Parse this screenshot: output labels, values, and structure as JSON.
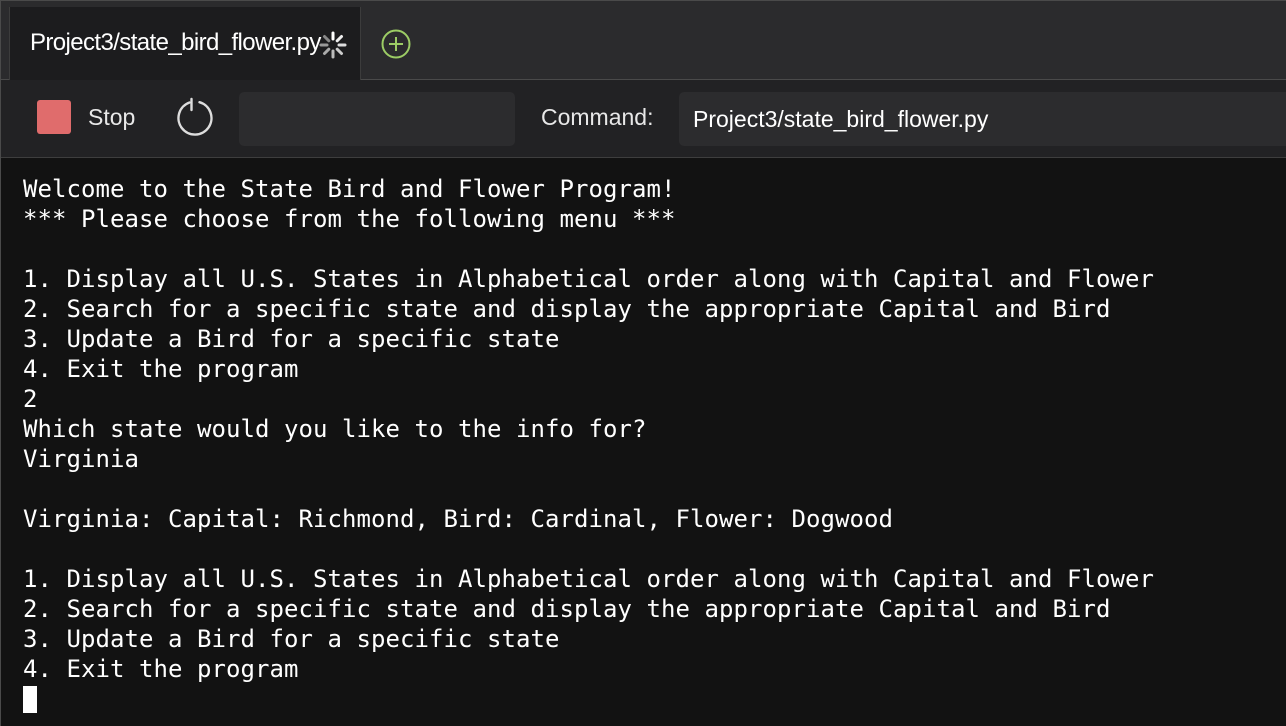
{
  "tab": {
    "title": "Project3/state_bird_flower.py",
    "status_icon": "loading-spinner-icon",
    "new_tab_icon": "plus-circle-icon"
  },
  "toolbar": {
    "stop_label": "Stop",
    "restart_icon": "restart-icon",
    "command_label": "Command:",
    "command_value": "Project3/state_bird_flower.py"
  },
  "terminal": {
    "lines": [
      "Welcome to the State Bird and Flower Program!",
      "*** Please choose from the following menu ***",
      "",
      "1. Display all U.S. States in Alphabetical order along with Capital and Flower",
      "2. Search for a specific state and display the appropriate Capital and Bird",
      "3. Update a Bird for a specific state",
      "4. Exit the program",
      "2",
      "Which state would you like to the info for?",
      "Virginia",
      "",
      "Virginia: Capital: Richmond, Bird: Cardinal, Flower: Dogwood",
      "",
      "1. Display all U.S. States in Alphabetical order along with Capital and Flower",
      "2. Search for a specific state and display the appropriate Capital and Bird",
      "3. Update a Bird for a specific state",
      "4. Exit the program"
    ]
  },
  "colors": {
    "stop": "#e06c6c",
    "accent_green": "#9ccc65",
    "background": "#121212"
  }
}
